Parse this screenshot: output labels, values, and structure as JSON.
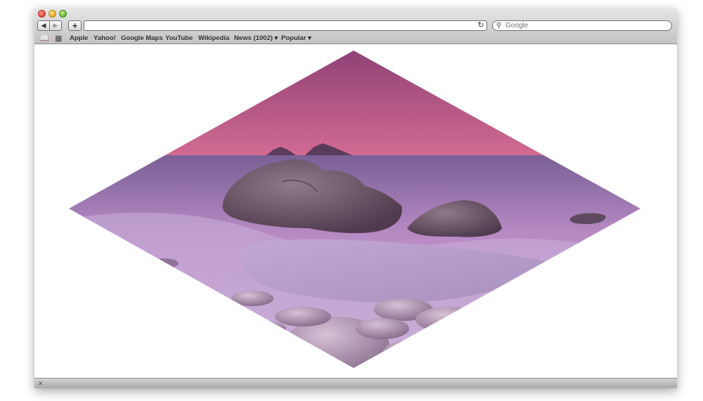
{
  "toolbar": {
    "back_glyph": "◀",
    "forward_glyph": "▶",
    "add_glyph": "+",
    "url_value": "",
    "reload_glyph": "↻",
    "search_icon_glyph": "⚲",
    "search_placeholder": "Google"
  },
  "bookmarks": {
    "book_icon_glyph": "📖",
    "grid_icon_glyph": "▦",
    "items": [
      {
        "label": "Apple"
      },
      {
        "label": "Yahoo!"
      },
      {
        "label": "Google Maps"
      },
      {
        "label": "YouTube"
      },
      {
        "label": "Wikipedia"
      },
      {
        "label": "News (1002) ▾"
      },
      {
        "label": "Popular ▾"
      }
    ]
  },
  "statusbar": {
    "icon_glyph": "✕"
  },
  "photo": {
    "colors": {
      "sky_top": "#8c3f74",
      "sky_bottom": "#d36b92",
      "sea": "#b88ac4",
      "sand": "#a98fbf",
      "rock": "#4f3a4e"
    }
  }
}
